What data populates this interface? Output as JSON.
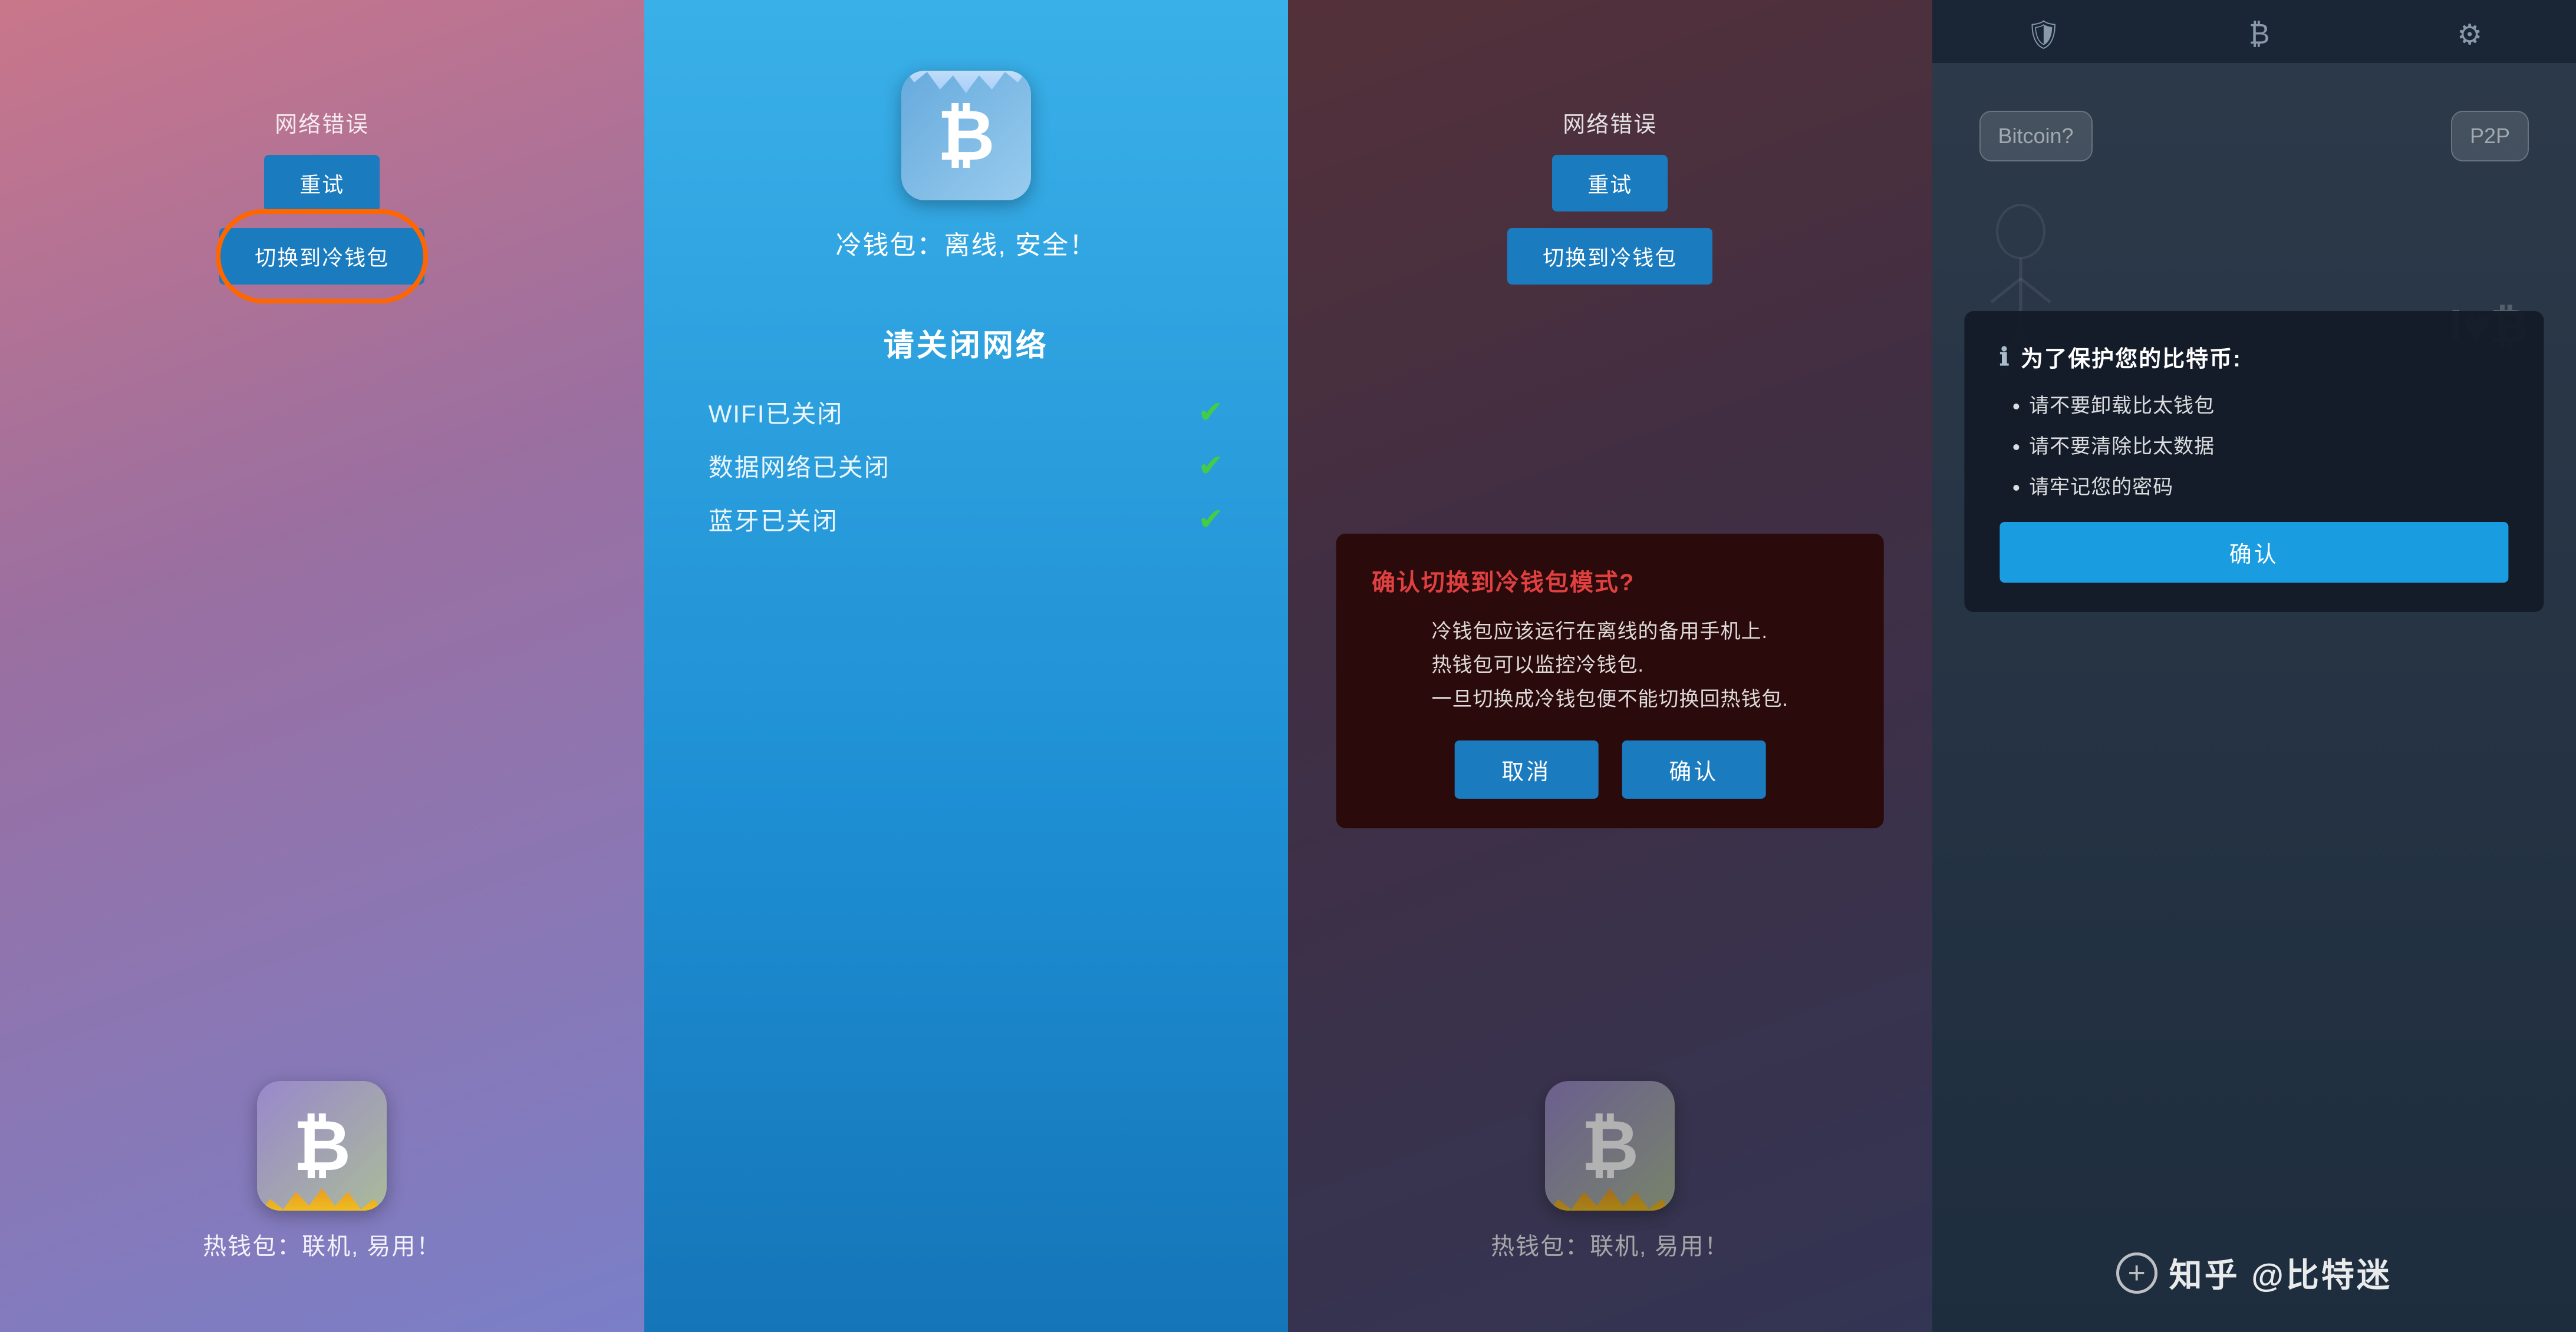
{
  "panel1": {
    "network_error_label": "网络错误",
    "retry_btn": "重试",
    "switch_btn": "切换到冷钱包",
    "bottom_label": "热钱包：联机, 易用！"
  },
  "panel2": {
    "cold_wallet_title": "冷钱包：离线, 安全！",
    "turn_off_label": "请关闭网络",
    "wifi_label": "WIFI已关闭",
    "data_label": "数据网络已关闭",
    "bluetooth_label": "蓝牙已关闭"
  },
  "panel3": {
    "network_error_label": "网络错误",
    "retry_btn": "重试",
    "switch_btn": "切换到冷钱包",
    "dialog_title": "确认切换到冷钱包模式?",
    "dialog_body": "冷钱包应该运行在离线的备用手机上.\n热钱包可以监控冷钱包.\n一旦切换成冷钱包便不能切换回热钱包.",
    "cancel_btn": "取消",
    "confirm_btn": "确认",
    "bottom_label": "热钱包：联机, 易用！"
  },
  "panel4": {
    "header": {
      "shield_icon": "🛡",
      "bitcoin_icon": "₿",
      "gear_icon": "⚙"
    },
    "speech_left": "Bitcoin?",
    "speech_right": "P2P",
    "ilovbtc": "I♥B",
    "protect_title": "为了保护您的比特币:",
    "protect_items": [
      "请不要卸载比太钱包",
      "请不要清除比太数据",
      "请牢记您的密码"
    ],
    "confirm_btn": "确认",
    "watermark": "知乎 @比特迷"
  }
}
